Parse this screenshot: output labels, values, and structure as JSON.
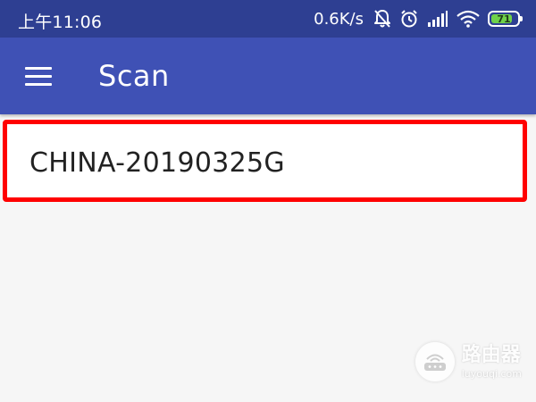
{
  "status_bar": {
    "time": "上午11:06",
    "network_speed": "0.6K/s",
    "battery_level": "71",
    "icons": [
      "alarm-off-icon",
      "alarm-clock-icon",
      "cellular-signal-icon",
      "wifi-icon",
      "battery-icon"
    ]
  },
  "app_bar": {
    "menu_icon": "hamburger-menu-icon",
    "title": "Scan"
  },
  "networks": [
    {
      "ssid": "CHINA-20190325G",
      "highlighted": true
    }
  ],
  "watermark": {
    "title": "路由器",
    "url": "luyouqi.com"
  },
  "colors": {
    "status_bar": "#2e3f92",
    "app_bar": "#3f51b5",
    "highlight_border": "#ff0000",
    "background": "#f6f6f6",
    "battery_fill": "#6fd24a"
  }
}
